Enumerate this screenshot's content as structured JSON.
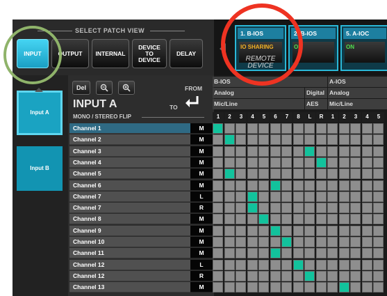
{
  "patch_view": {
    "title": "SELECT PATCH VIEW",
    "buttons": [
      {
        "label": "INPUT",
        "active": true
      },
      {
        "label": "OUTPUT",
        "active": false
      },
      {
        "label": "INTERNAL",
        "active": false
      },
      {
        "label": "DEVICE TO DEVICE",
        "active": false
      },
      {
        "label": "DELAY",
        "active": false
      }
    ]
  },
  "devices": [
    {
      "name": "1. B-IOS",
      "status": "IO SHARING",
      "status_color": "#f5b324",
      "sub": "REMOTE DEVICE"
    },
    {
      "name": "2. B-IOS",
      "status": "ON",
      "status_color": "#4fe04f"
    },
    {
      "name": "5. A-IOC",
      "status": "ON",
      "status_color": "#4fe04f"
    }
  ],
  "sidebar": {
    "items": [
      {
        "label": "Input A",
        "selected": true
      },
      {
        "label": "Input B",
        "selected": false
      }
    ]
  },
  "toolbar": {
    "del": "Del",
    "zoom_out_icon": "zoom-out-icon",
    "zoom_in_icon": "zoom-in-icon"
  },
  "header": {
    "from": "FROM",
    "to": "TO",
    "title": "INPUT A",
    "flip": "MONO / STEREO FLIP"
  },
  "matrix_headers": {
    "group1": {
      "device": "B-IOS",
      "type_analog": "Analog",
      "type_digital": "Digital",
      "level": "Mic/Line",
      "aes": "AES"
    },
    "group2": {
      "device": "A-IOS",
      "type": "Analog",
      "level": "Mic/Line"
    },
    "columns": [
      "1",
      "2",
      "3",
      "4",
      "5",
      "6",
      "7",
      "8",
      "L",
      "R",
      "1",
      "2",
      "3",
      "4",
      "5"
    ]
  },
  "channels": [
    {
      "name": "Channel 1",
      "mode": "M"
    },
    {
      "name": "Channel 2",
      "mode": "M"
    },
    {
      "name": "Channel 3",
      "mode": "M"
    },
    {
      "name": "Channel 4",
      "mode": "M"
    },
    {
      "name": "Channel 5",
      "mode": "M"
    },
    {
      "name": "Channel 6",
      "mode": "M"
    },
    {
      "name": "Channel 7",
      "mode": "L"
    },
    {
      "name": "Channel 7",
      "mode": "R"
    },
    {
      "name": "Channel 8",
      "mode": "M"
    },
    {
      "name": "Channel 9",
      "mode": "M"
    },
    {
      "name": "Channel 10",
      "mode": "M"
    },
    {
      "name": "Channel 11",
      "mode": "M"
    },
    {
      "name": "Channel 12",
      "mode": "L"
    },
    {
      "name": "Channel 12",
      "mode": "R"
    },
    {
      "name": "Channel 13",
      "mode": "M"
    }
  ],
  "patched": [
    0,
    1,
    8,
    9,
    1,
    5,
    3,
    3,
    4,
    5,
    6,
    5,
    7,
    8,
    11
  ],
  "colors": {
    "accent": "#1aa3c2",
    "patch_on": "#12c29c",
    "cell_off": "#8e8e8e"
  }
}
